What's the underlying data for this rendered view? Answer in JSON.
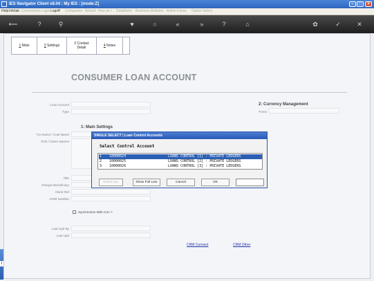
{
  "window": {
    "title": "IES Navigator Client v8.04 : My IES :   [mode:Z]",
    "controls": [
      "minimize",
      "maximize",
      "close"
    ]
  },
  "menubar": {
    "items": [
      {
        "label": "Help",
        "enabled": true
      },
      {
        "label": "Infolab",
        "enabled": true
      },
      {
        "label": "Connections",
        "enabled": false
      },
      {
        "label": "Login",
        "enabled": false
      },
      {
        "label": "Logoff",
        "enabled": true
      },
      {
        "label": "Companies",
        "enabled": false
      },
      {
        "label": "Wizard",
        "enabled": false
      },
      {
        "label": "How do I",
        "enabled": false
      },
      {
        "label": "DataMarts",
        "enabled": false
      },
      {
        "label": "Business Modules",
        "enabled": false
      },
      {
        "label": "Action Focus",
        "enabled": false
      },
      {
        "label": "Option Select",
        "enabled": false
      }
    ]
  },
  "toolbar": {
    "icons": [
      "back-arrow-icon",
      "help-icon",
      "search-icon",
      "heart-icon",
      "circle-icon",
      "rewind-icon",
      "fast-forward-icon",
      "help-icon",
      "home-icon",
      "gear-icon",
      "check-icon",
      "close-icon"
    ]
  },
  "tabs": [
    {
      "key": "1",
      "label": "Main"
    },
    {
      "key": "2",
      "label": "Settings"
    },
    {
      "key": "3",
      "label": "Contact Detail",
      "line1": "3 Contact",
      "line2": "Detail"
    },
    {
      "key": "4",
      "label": "Notes"
    }
  ],
  "form": {
    "title": "CONSUMER LOAN ACCOUNT",
    "loan_account_label": "Loan Account",
    "type_label": "Type",
    "currency_section": "2: Currency Management",
    "forex_label": "Forex",
    "main_section": "1: Main Settings",
    "co_name_label": "*Co Name / Cust Name",
    "first_given_label": "First / Given Names",
    "title_label": "Title",
    "cheque_beneficiary_label": "Cheque Beneficiary",
    "client_ref_label": "Client Ref",
    "crm_number_label": "CRM Number",
    "sync_crm_label": "Synchronize With Crm ?",
    "last_upd_by_label": "Last Upd By",
    "last_upd_label": "Last Upd",
    "crm_connect_link": "CRM Connect",
    "crm_other_link": "CRM Other"
  },
  "dialog": {
    "title": "SINGLE SELECT | Loan Control Accounts",
    "heading": "Select Control Account",
    "rows": [
      {
        "num": "1",
        "code": "10000024",
        "desc": "LOANS CONTROL [1] : PRIVATE LEDGERS",
        "selected": true
      },
      {
        "num": "2",
        "code": "10000025",
        "desc": "LOANS CONTROL [2] : PRIVATE LEDGERS",
        "selected": false
      },
      {
        "num": "3",
        "code": "10000026",
        "desc": "LOANS CONTROL [3] : PRIVATE LEDGERS",
        "selected": false
      }
    ],
    "buttons": {
      "select_all": "Select ALL",
      "show_full_line": "Show Full Line",
      "cancel": "Cancel",
      "ok": "OK"
    },
    "input_value": ""
  },
  "colors": {
    "titlebar": "#2f65c0",
    "selection": "#2b5fb4",
    "toolbar": "#1e1e1e",
    "link": "#2233aa"
  }
}
